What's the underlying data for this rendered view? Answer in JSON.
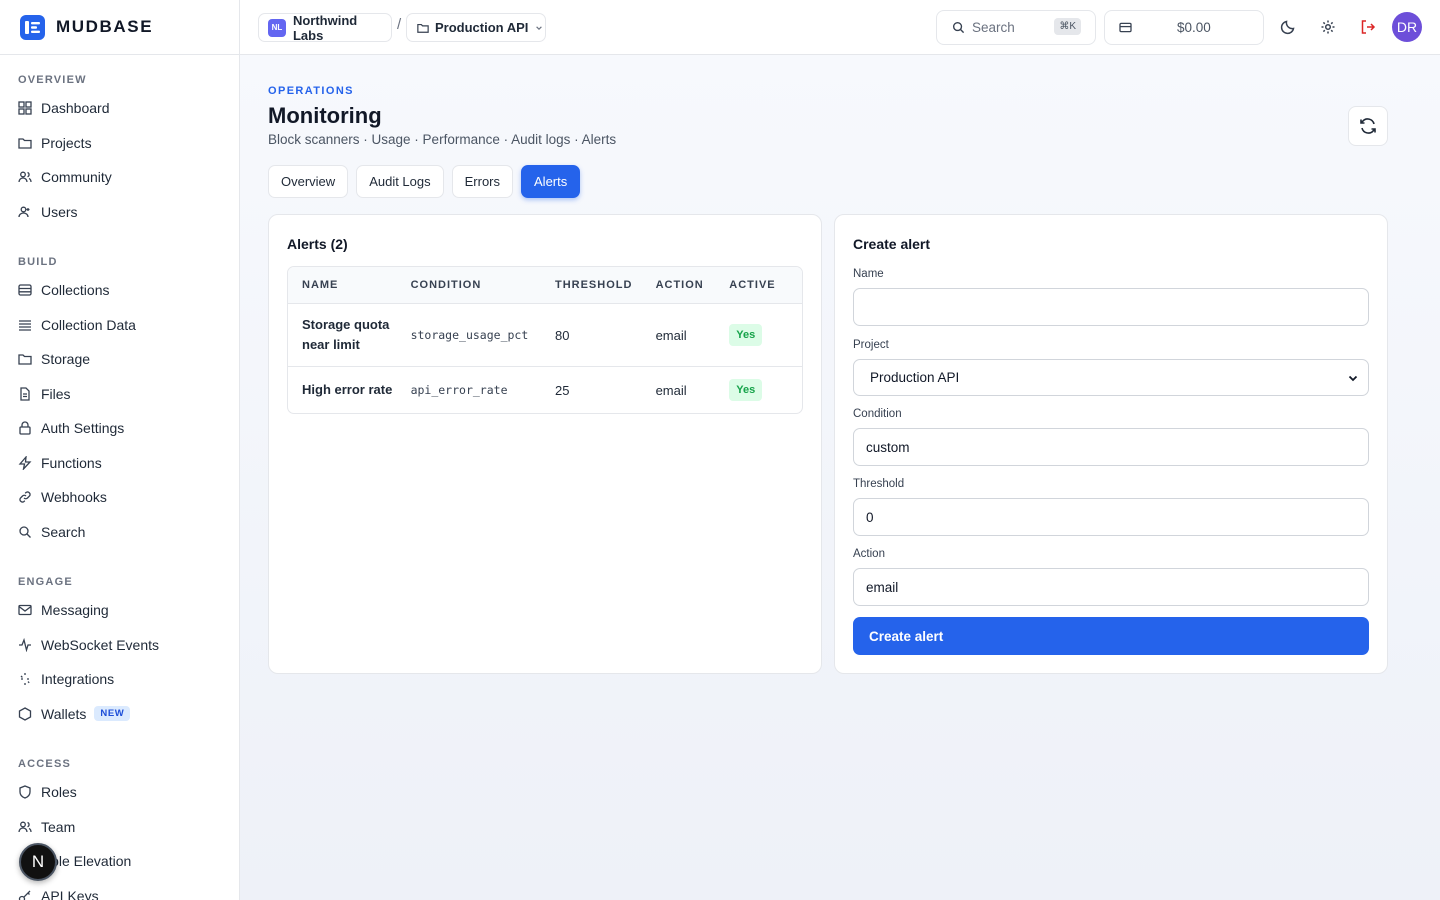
{
  "app": {
    "name": "MUDBASE"
  },
  "sidebar": {
    "sections": [
      {
        "title": "OVERVIEW",
        "items": [
          {
            "label": "Dashboard",
            "icon": "grid-icon"
          },
          {
            "label": "Projects",
            "icon": "folder-icon"
          },
          {
            "label": "Community",
            "icon": "users-icon"
          },
          {
            "label": "Users",
            "icon": "user-icon"
          }
        ]
      },
      {
        "title": "BUILD",
        "items": [
          {
            "label": "Collections",
            "icon": "database-icon"
          },
          {
            "label": "Collection Data",
            "icon": "list-icon"
          },
          {
            "label": "Storage",
            "icon": "folder-icon"
          },
          {
            "label": "Files",
            "icon": "file-icon"
          },
          {
            "label": "Auth Settings",
            "icon": "lock-icon"
          },
          {
            "label": "Functions",
            "icon": "bolt-icon"
          },
          {
            "label": "Webhooks",
            "icon": "link-icon"
          },
          {
            "label": "Search",
            "icon": "search-icon"
          }
        ]
      },
      {
        "title": "ENGAGE",
        "items": [
          {
            "label": "Messaging",
            "icon": "mail-icon"
          },
          {
            "label": "WebSocket Events",
            "icon": "activity-icon"
          },
          {
            "label": "Integrations",
            "icon": "sparkle-icon"
          },
          {
            "label": "Wallets",
            "icon": "hexagon-icon",
            "badge": "NEW"
          }
        ]
      },
      {
        "title": "ACCESS",
        "items": [
          {
            "label": "Roles",
            "icon": "shield-icon"
          },
          {
            "label": "Team",
            "icon": "users-icon"
          },
          {
            "label": "Role Elevation",
            "icon": "arrow-up-icon"
          },
          {
            "label": "API Keys",
            "icon": "key-icon"
          }
        ]
      }
    ],
    "floating_avatar": "N"
  },
  "topbar": {
    "org": {
      "initials": "NL",
      "name": "Northwind Labs"
    },
    "separator": "/",
    "project": {
      "name": "Production API"
    },
    "search": {
      "label": "Search",
      "shortcut": "⌘K"
    },
    "credits": "$0.00",
    "user_initials": "DR"
  },
  "page": {
    "eyebrow": "OPERATIONS",
    "title": "Monitoring",
    "subtitle": "Block scanners · Usage · Performance · Audit logs · Alerts",
    "tabs": [
      {
        "label": "Overview",
        "active": false
      },
      {
        "label": "Audit Logs",
        "active": false
      },
      {
        "label": "Errors",
        "active": false
      },
      {
        "label": "Alerts",
        "active": true
      }
    ]
  },
  "alerts": {
    "title": "Alerts (2)",
    "columns": [
      "NAME",
      "CONDITION",
      "THRESHOLD",
      "ACTION",
      "ACTIVE"
    ],
    "rows": [
      {
        "name": "Storage quota near limit",
        "condition": "storage_usage_pct",
        "threshold": "80",
        "action": "email",
        "active": "Yes"
      },
      {
        "name": "High error rate",
        "condition": "api_error_rate",
        "threshold": "25",
        "action": "email",
        "active": "Yes"
      }
    ]
  },
  "create_form": {
    "title": "Create alert",
    "name_label": "Name",
    "name_value": "",
    "project_label": "Project",
    "project_value": "Production API",
    "condition_label": "Condition",
    "condition_value": "custom",
    "threshold_label": "Threshold",
    "threshold_value": "0",
    "action_label": "Action",
    "action_value": "email",
    "submit_label": "Create alert"
  },
  "colors": {
    "accent": "#2563eb",
    "success_bg": "#dcfce7",
    "success_text": "#16a34a",
    "logout": "#dc2626"
  }
}
